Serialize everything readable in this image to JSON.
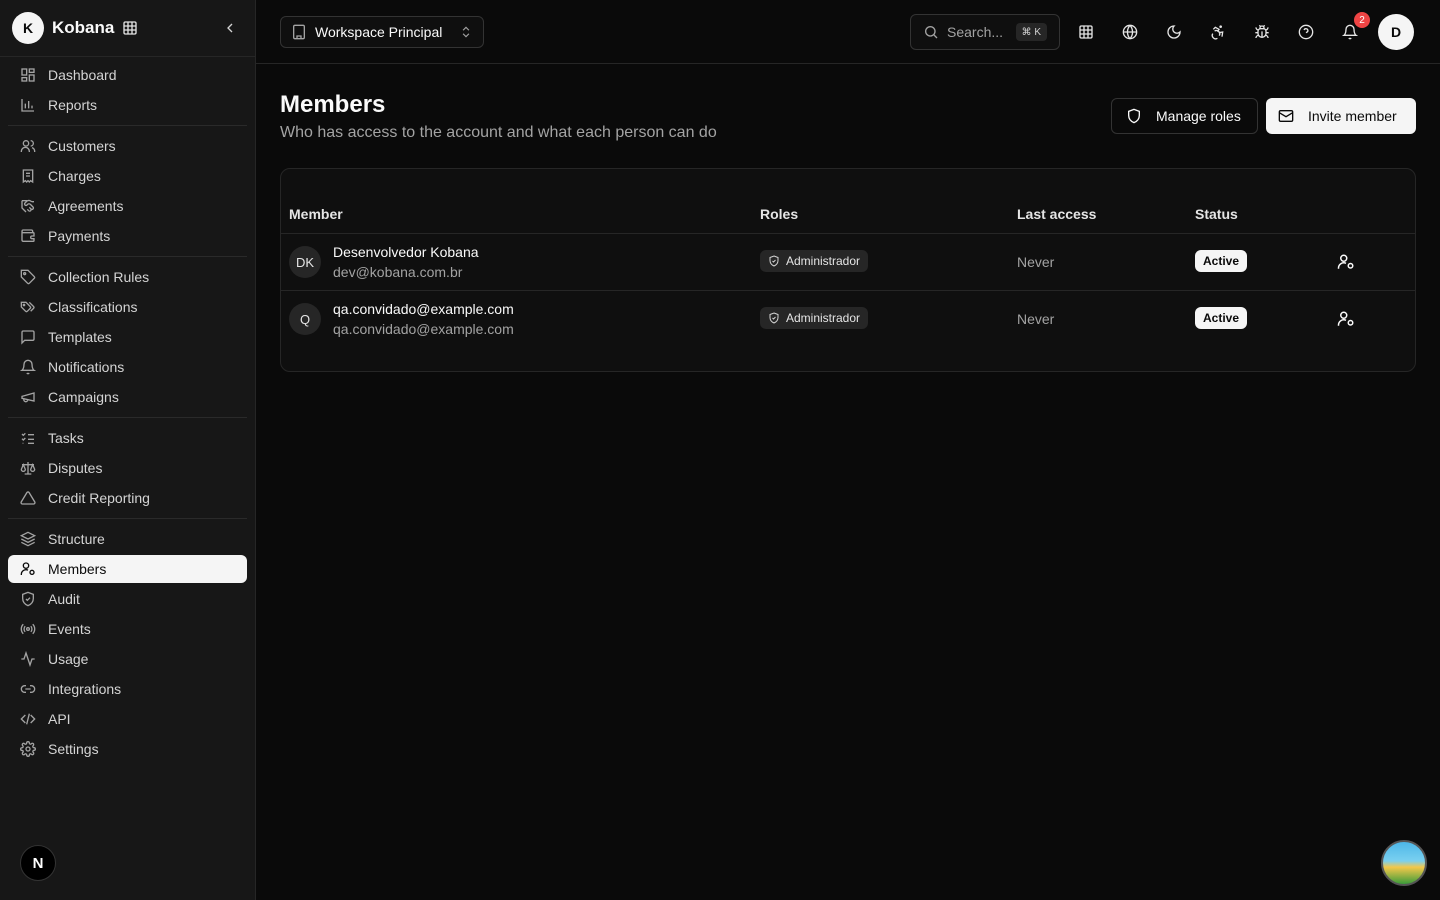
{
  "brand": {
    "avatar_letter": "K",
    "name": "Kobana"
  },
  "sidebar": {
    "groups": [
      [
        {
          "label": "Dashboard",
          "icon": "layout-grid-icon"
        },
        {
          "label": "Reports",
          "icon": "bar-chart-icon"
        }
      ],
      [
        {
          "label": "Customers",
          "icon": "users-icon"
        },
        {
          "label": "Charges",
          "icon": "receipt-icon"
        },
        {
          "label": "Agreements",
          "icon": "handshake-icon"
        },
        {
          "label": "Payments",
          "icon": "wallet-icon"
        }
      ],
      [
        {
          "label": "Collection Rules",
          "icon": "tag-icon"
        },
        {
          "label": "Classifications",
          "icon": "tags-icon"
        },
        {
          "label": "Templates",
          "icon": "message-square-icon"
        },
        {
          "label": "Notifications",
          "icon": "bell-icon"
        },
        {
          "label": "Campaigns",
          "icon": "megaphone-icon"
        }
      ],
      [
        {
          "label": "Tasks",
          "icon": "list-checks-icon"
        },
        {
          "label": "Disputes",
          "icon": "scale-icon"
        },
        {
          "label": "Credit Reporting",
          "icon": "alert-triangle-icon"
        }
      ],
      [
        {
          "label": "Structure",
          "icon": "layers-icon"
        },
        {
          "label": "Members",
          "icon": "user-cog-icon",
          "active": true
        },
        {
          "label": "Audit",
          "icon": "shield-check-icon"
        },
        {
          "label": "Events",
          "icon": "radio-icon"
        },
        {
          "label": "Usage",
          "icon": "activity-icon"
        },
        {
          "label": "Integrations",
          "icon": "link-icon"
        },
        {
          "label": "API",
          "icon": "code-icon"
        },
        {
          "label": "Settings",
          "icon": "settings-icon"
        }
      ]
    ],
    "footer_badge": "N"
  },
  "topbar": {
    "workspace": "Workspace Principal",
    "search_placeholder": "Search...",
    "search_shortcut": "⌘ K",
    "notification_count": "2",
    "user_initial": "D"
  },
  "page": {
    "title": "Members",
    "subtitle": "Who has access to the account and what each person can do",
    "manage_roles_label": "Manage roles",
    "invite_member_label": "Invite member"
  },
  "table": {
    "headers": {
      "member": "Member",
      "roles": "Roles",
      "last_access": "Last access",
      "status": "Status"
    },
    "rows": [
      {
        "initials": "DK",
        "name": "Desenvolvedor Kobana",
        "email": "dev@kobana.com.br",
        "role": "Administrador",
        "last_access": "Never",
        "status": "Active"
      },
      {
        "initials": "Q",
        "name": "qa.convidado@example.com",
        "email": "qa.convidado@example.com",
        "role": "Administrador",
        "last_access": "Never",
        "status": "Active"
      }
    ]
  }
}
